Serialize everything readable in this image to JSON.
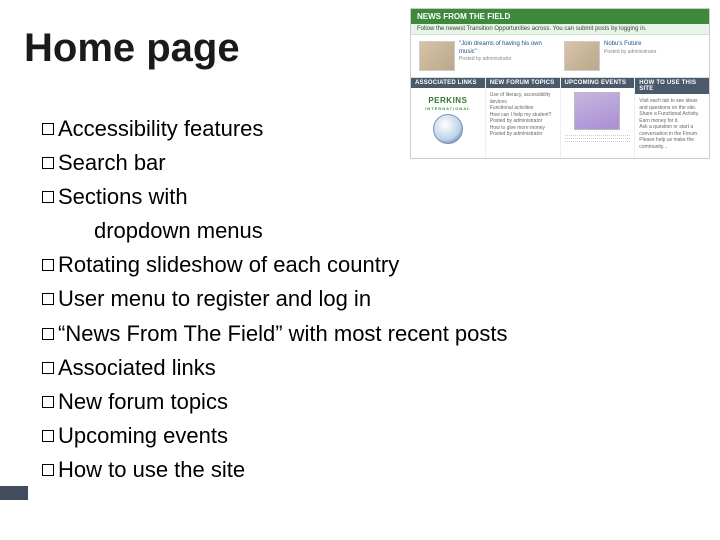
{
  "title": "Home page",
  "bullets": [
    {
      "text": "Accessibility features",
      "wrap": null
    },
    {
      "text": "Search bar",
      "wrap": null
    },
    {
      "text": "Sections with",
      "wrap": "dropdown menus"
    },
    {
      "text": "Rotating slideshow of each country",
      "wrap": null
    },
    {
      "text": "User menu to register and log in",
      "wrap": null
    },
    {
      "text": "“News From The Field” with most recent posts",
      "wrap": null
    },
    {
      "text": "Associated links",
      "wrap": null
    },
    {
      "text": "New forum topics",
      "wrap": null
    },
    {
      "text": "Upcoming events",
      "wrap": null
    },
    {
      "text": "How to use the site",
      "wrap": null
    }
  ],
  "preview": {
    "news_header": "NEWS FROM THE FIELD",
    "news_sub": "Follow the newest Transition Opportunities across. You can submit posts by logging in.",
    "cards": [
      {
        "title": "\"Join dreams of having his own music\"",
        "posted": "Posted by administrator"
      },
      {
        "title": "Nobu's Future",
        "posted": "Posted by administrator"
      }
    ],
    "cols": [
      {
        "header": "ASSOCIATED LINKS",
        "body_type": "logos"
      },
      {
        "header": "NEW FORUM TOPICS",
        "body_type": "forum"
      },
      {
        "header": "UPCOMING EVENTS",
        "body_type": "events"
      },
      {
        "header": "HOW TO USE THIS SITE",
        "body_type": "howto"
      }
    ],
    "logos": {
      "name1": "PERKINS",
      "name1_sub": "INTERNATIONAL"
    },
    "forum_lines": [
      "Use of literacy, accessibility devices",
      "Functional activities",
      "How can I help my student?",
      "Posted by administrator",
      "How to give more money",
      "Posted by administrator"
    ],
    "howto_lines": [
      "Visit each tab to see ideas and questions on the site.",
      "Share a Functional Activity. Earn money for it.",
      "Ask a question or start a conversation in the Forum.",
      "Please help us make the community..."
    ],
    "event_lines": [
      "",
      "",
      ""
    ]
  }
}
